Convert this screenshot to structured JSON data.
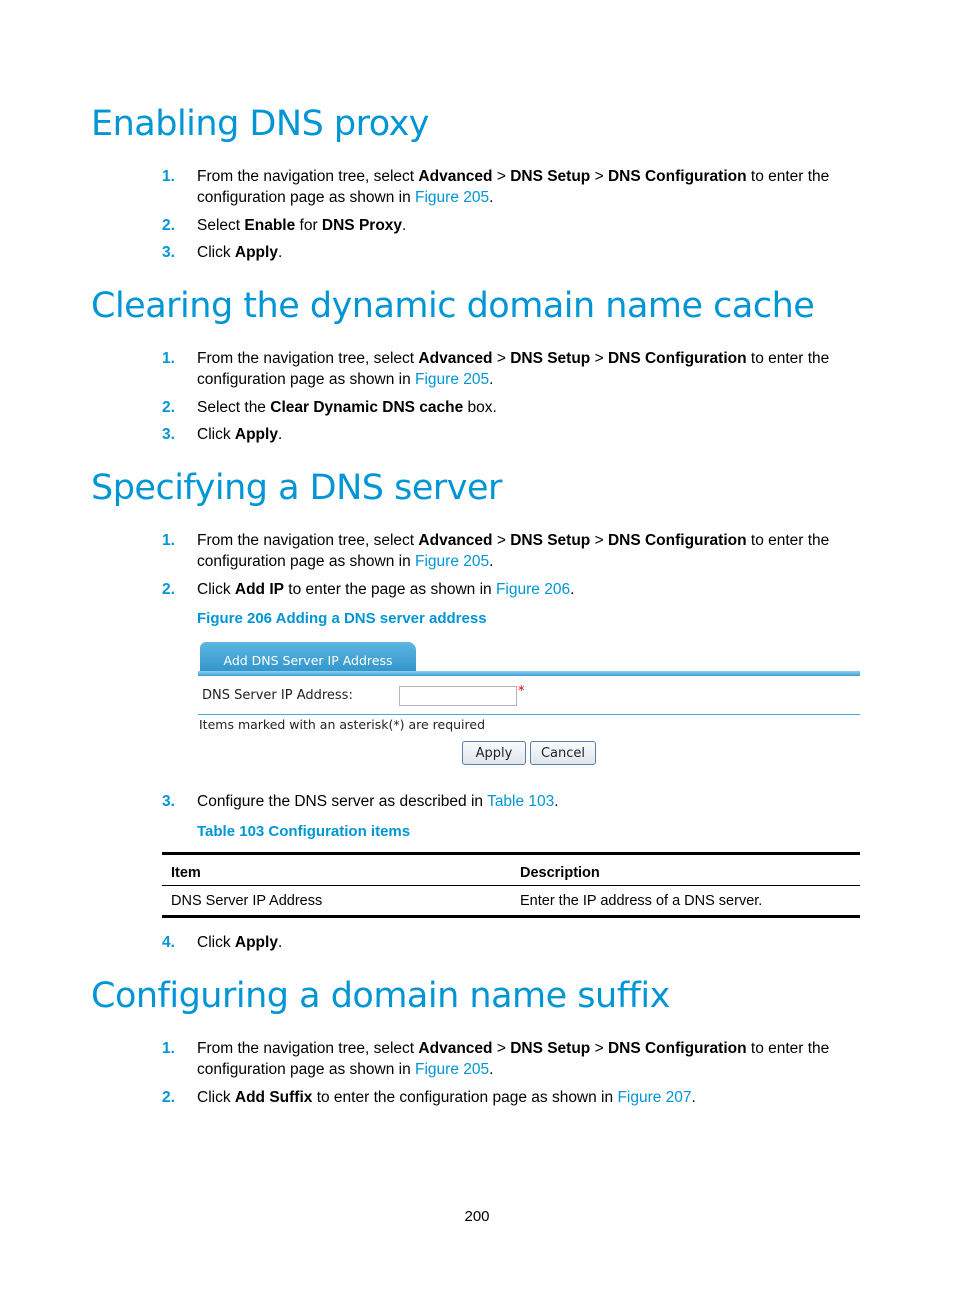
{
  "sections": [
    {
      "title": "Enabling DNS proxy",
      "steps": [
        {
          "num": "1.",
          "parts": [
            "From the navigation tree, select ",
            "Advanced",
            " > ",
            "DNS Setup",
            " > ",
            "DNS Configuration",
            " to enter the configuration page as shown in ",
            "Figure 205",
            "."
          ]
        },
        {
          "num": "2.",
          "parts": [
            "Select ",
            "Enable",
            " for ",
            "DNS Proxy",
            "."
          ]
        },
        {
          "num": "3.",
          "parts": [
            "Click ",
            "Apply",
            "."
          ]
        }
      ]
    },
    {
      "title": "Clearing the dynamic domain name cache",
      "steps": [
        {
          "num": "1.",
          "parts": [
            "From the navigation tree, select ",
            "Advanced",
            " > ",
            "DNS Setup",
            " > ",
            "DNS Configuration",
            " to enter the configuration page as shown in ",
            "Figure 205",
            "."
          ]
        },
        {
          "num": "2.",
          "parts": [
            "Select the ",
            "Clear Dynamic DNS cache",
            " box."
          ]
        },
        {
          "num": "3.",
          "parts": [
            "Click ",
            "Apply",
            "."
          ]
        }
      ]
    },
    {
      "title": "Specifying a DNS server",
      "steps": [
        {
          "num": "1.",
          "parts": [
            "From the navigation tree, select ",
            "Advanced",
            " > ",
            "DNS Setup",
            " > ",
            "DNS Configuration",
            " to enter the configuration page as shown in ",
            "Figure 205",
            "."
          ]
        },
        {
          "num": "2.",
          "parts": [
            "Click ",
            "Add IP",
            " to enter the page as shown in ",
            "Figure 206",
            "."
          ]
        },
        {
          "num": "3.",
          "parts": [
            "Configure the DNS server as described in ",
            "Table 103",
            "."
          ]
        },
        {
          "num": "4.",
          "parts": [
            "Click ",
            "Apply",
            "."
          ]
        }
      ],
      "figure": {
        "caption": "Figure 206 Adding a DNS server address",
        "tab_label": "Add DNS Server IP Address",
        "field_label": "DNS Server IP Address:",
        "field_value": "",
        "required_mark": "*",
        "note": "Items marked with an asterisk(*) are required",
        "apply_label": "Apply",
        "cancel_label": "Cancel"
      },
      "table": {
        "caption": "Table 103 Configuration items",
        "headers": [
          "Item",
          "Description"
        ],
        "rows": [
          [
            "DNS Server IP Address",
            "Enter the IP address of a DNS server."
          ]
        ]
      }
    },
    {
      "title": "Configuring a domain name suffix",
      "steps": [
        {
          "num": "1.",
          "parts": [
            "From the navigation tree, select ",
            "Advanced",
            " > ",
            "DNS Setup",
            " > ",
            "DNS Configuration",
            " to enter the configuration page as shown in ",
            "Figure 205",
            "."
          ]
        },
        {
          "num": "2.",
          "parts": [
            "Click ",
            "Add Suffix",
            " to enter the configuration page as shown in ",
            "Figure 207",
            "."
          ]
        }
      ]
    }
  ],
  "page_number": "200",
  "colors": {
    "accent": "#0096d6",
    "tab_blue": "#2a92c9",
    "required": "#e00000"
  }
}
